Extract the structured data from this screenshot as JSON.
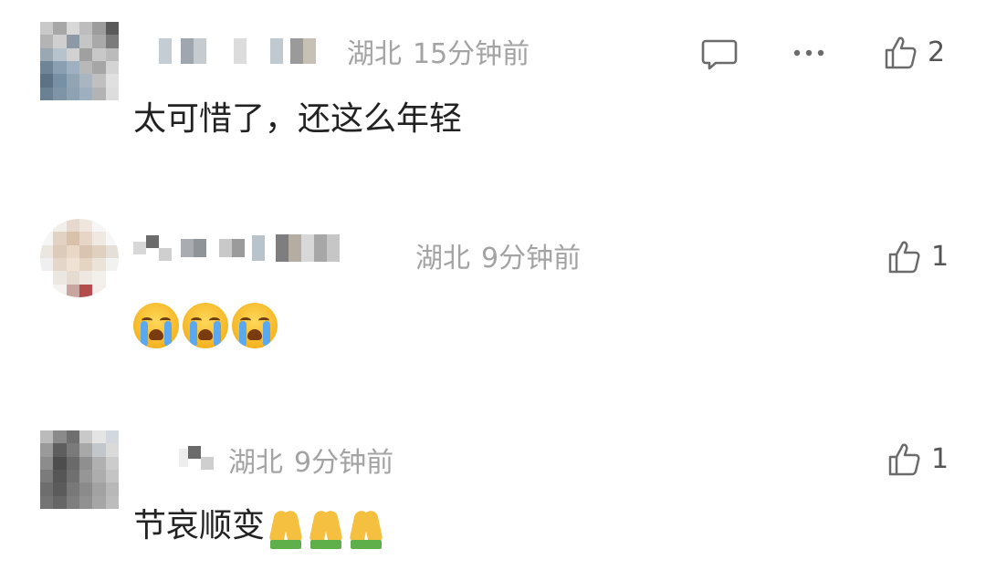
{
  "comments": [
    {
      "location": "湖北",
      "time": "15分钟前",
      "text": "太可惜了，还这么年轻",
      "like_count": "2",
      "show_reply": true,
      "show_more": true,
      "emoji": []
    },
    {
      "location": "湖北",
      "time": "9分钟前",
      "text": "",
      "like_count": "1",
      "show_reply": false,
      "show_more": false,
      "emoji": [
        "crying-face",
        "crying-face",
        "crying-face"
      ]
    },
    {
      "location": "湖北",
      "time": "9分钟前",
      "text": "节哀顺变",
      "like_count": "1",
      "show_reply": false,
      "show_more": false,
      "emoji": [
        "folded-hands",
        "folded-hands",
        "folded-hands"
      ]
    }
  ],
  "icons": {
    "reply": "comment-bubble-icon",
    "more": "ellipsis-icon",
    "like": "thumbs-up-icon"
  },
  "colors": {
    "meta_text": "#a3a3a3",
    "body_text": "#222222",
    "icon": "#6b6b6b",
    "background": "#ffffff"
  }
}
